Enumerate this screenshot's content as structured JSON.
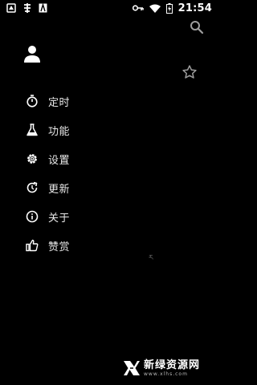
{
  "status_bar": {
    "time": "21:54",
    "left_icons": [
      "vpn-key-icon",
      "bug-icon",
      "nfc-icon"
    ],
    "right_icons": [
      "key-icon",
      "wifi-icon",
      "battery-icon"
    ]
  },
  "header": {
    "search_icon": "search-icon",
    "star_icon": "star-outline-icon",
    "avatar_icon": "person-icon"
  },
  "menu": {
    "items": [
      {
        "label": "定时",
        "icon": "timer-icon"
      },
      {
        "label": "功能",
        "icon": "flask-icon"
      },
      {
        "label": "设置",
        "icon": "gear-icon"
      },
      {
        "label": "更新",
        "icon": "refresh-icon"
      },
      {
        "label": "关于",
        "icon": "info-icon"
      },
      {
        "label": "赞赏",
        "icon": "thumb-up-icon"
      }
    ]
  },
  "misc": {
    "tiny_mark": "ར"
  },
  "watermark": {
    "cn": "新绿资源网",
    "en": "www.xlhs.com"
  },
  "colors": {
    "background": "#000000",
    "text": "#ffffff",
    "icon_gray": "#9e9e9e"
  }
}
